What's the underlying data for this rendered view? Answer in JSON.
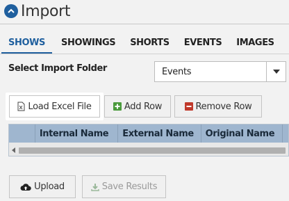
{
  "header": {
    "title": "Import",
    "collapse_icon": "chevron-up-circle-icon"
  },
  "tabs": [
    {
      "label": "SHOWS",
      "active": true
    },
    {
      "label": "SHOWINGS",
      "active": false
    },
    {
      "label": "SHORTS",
      "active": false
    },
    {
      "label": "EVENTS",
      "active": false
    },
    {
      "label": "IMAGES",
      "active": false
    }
  ],
  "folder": {
    "label": "Select Import Folder",
    "selected": "Events"
  },
  "toolbar": {
    "load_label": "Load Excel File",
    "add_row_label": "Add Row",
    "remove_row_label": "Remove Row"
  },
  "grid": {
    "columns": [
      "",
      "Internal Name",
      "External Name",
      "Original Name",
      ""
    ]
  },
  "actions": {
    "upload_label": "Upload",
    "save_label": "Save Results",
    "save_disabled": true
  },
  "colors": {
    "accent": "#1f5f9e",
    "add_icon": "#4a9a3c",
    "remove_icon": "#c0392b",
    "grid_header": "#9fb6cf"
  }
}
